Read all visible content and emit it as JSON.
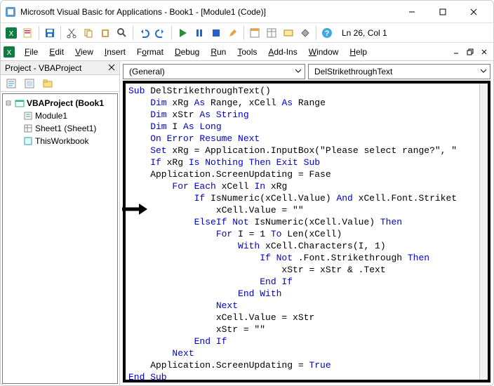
{
  "title": "Microsoft Visual Basic for Applications - Book1 - [Module1 (Code)]",
  "cursor_position": "Ln 26, Col 1",
  "menus": {
    "file": "File",
    "edit": "Edit",
    "view": "View",
    "insert": "Insert",
    "format": "Format",
    "debug": "Debug",
    "run": "Run",
    "tools": "Tools",
    "addins": "Add-Ins",
    "window": "Window",
    "help": "Help"
  },
  "project_pane": {
    "title": "Project - VBAProject",
    "root": "VBAProject (Book1",
    "items": [
      "Module1",
      "Sheet1 (Sheet1)",
      "ThisWorkbook"
    ]
  },
  "dropdowns": {
    "object": "(General)",
    "proc": "DelStrikethroughText"
  },
  "code": {
    "l01a": "Sub",
    "l01b": " DelStrikethroughText()",
    "l02a": "    Dim",
    "l02b": " xRg ",
    "l02c": "As",
    "l02d": " Range, xCell ",
    "l02e": "As",
    "l02f": " Range",
    "l03a": "    Dim",
    "l03b": " xStr ",
    "l03c": "As String",
    "l04a": "    Dim",
    "l04b": " I ",
    "l04c": "As Long",
    "l05": "    On Error Resume Next",
    "l06a": "    Set",
    "l06b": " xRg = Application.InputBox(\"Please select range?\", \"",
    "l07a": "    If",
    "l07b": " xRg ",
    "l07c": "Is Nothing Then Exit Sub",
    "l08": "    Application.ScreenUpdating = Fase",
    "l09a": "        For Each",
    "l09b": " xCell ",
    "l09c": "In",
    "l09d": " xRg",
    "l10a": "            If",
    "l10b": " IsNumeric(xCell.Value) ",
    "l10c": "And",
    "l10d": " xCell.Font.Striket",
    "l11": "                xCell.Value = \"\"",
    "l12a": "            ElseIf Not",
    "l12b": " IsNumeric(xCell.Value) ",
    "l12c": "Then",
    "l13a": "                For",
    "l13b": " I = 1 ",
    "l13c": "To",
    "l13d": " Len(xCell)",
    "l14a": "                    With",
    "l14b": " xCell.Characters(I, 1)",
    "l15a": "                        If Not",
    "l15b": " .Font.Strikethrough ",
    "l15c": "Then",
    "l16": "                            xStr = xStr & .Text",
    "l17": "                        End If",
    "l18": "                    End With",
    "l19": "                Next",
    "l20": "                xCell.Value = xStr",
    "l21": "                xStr = \"\"",
    "l22": "            End If",
    "l23": "        Next",
    "l24a": "    Application.ScreenUpdating = ",
    "l24b": "True",
    "l25": "End Sub"
  }
}
